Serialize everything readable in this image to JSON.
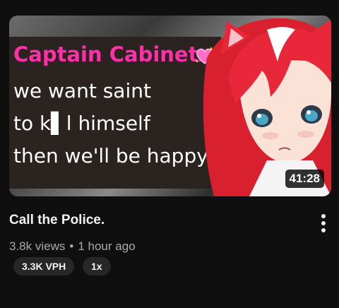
{
  "video": {
    "duration": "41:28",
    "title": "Call the Police.",
    "views": "3.8k views",
    "separator": "•",
    "age": "1 hour ago",
    "badges": [
      "3.3K VPH",
      "1x"
    ],
    "thumbnail_text": {
      "name": "Captain Cabinetz",
      "line1": "we want saint",
      "line2": "to k▌l himself",
      "line3": "then we'll be happy"
    }
  },
  "colors": {
    "background": "#0f0f0f",
    "name_pink": "#ff2fa8",
    "hair_red": "#e8283a",
    "meta_gray": "#aaaaaa",
    "chip_bg": "#272727"
  },
  "icons": [
    "sparkling-heart-icon",
    "more-vert-icon"
  ]
}
